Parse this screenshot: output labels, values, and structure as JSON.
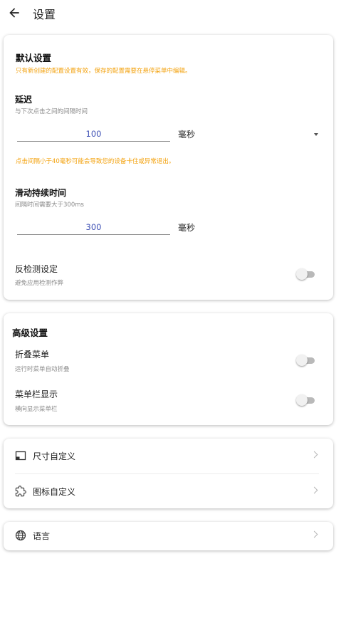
{
  "appbar": {
    "title": "设置",
    "back_icon": "arrow-back-icon"
  },
  "default_settings": {
    "title": "默认设置",
    "notice": "只有新创建的配置设置有效，保存的配置需要在悬停菜单中编辑。",
    "delay": {
      "title": "延迟",
      "subtitle": "与下次点击之间的间隔时间",
      "value": "100",
      "unit": "毫秒",
      "warning": "点击间隔小于40毫秒可能会导致您的设备卡住或异常退出。"
    },
    "swipe": {
      "title": "滑动持续时间",
      "subtitle": "间隔时间需要大于300ms",
      "value": "300",
      "unit": "毫秒"
    },
    "anti_detect": {
      "title": "反检测设定",
      "subtitle": "避免应用检测作弊",
      "enabled": false
    }
  },
  "advanced_settings": {
    "title": "高级设置",
    "fold_menu": {
      "title": "折叠菜单",
      "subtitle": "运行时菜单自动折叠",
      "enabled": false
    },
    "menu_bar": {
      "title": "菜单栏显示",
      "subtitle": "横向显示菜单栏",
      "enabled": false
    }
  },
  "customize": {
    "size": {
      "label": "尺寸自定义",
      "icon": "size-frame-icon"
    },
    "icon": {
      "label": "图标自定义",
      "icon": "puzzle-icon"
    }
  },
  "language": {
    "label": "语言",
    "icon": "globe-icon"
  },
  "colors": {
    "warning": "#f3a20e",
    "input_text": "#3f51b5",
    "toggle_off_track": "#b9b9b9"
  }
}
